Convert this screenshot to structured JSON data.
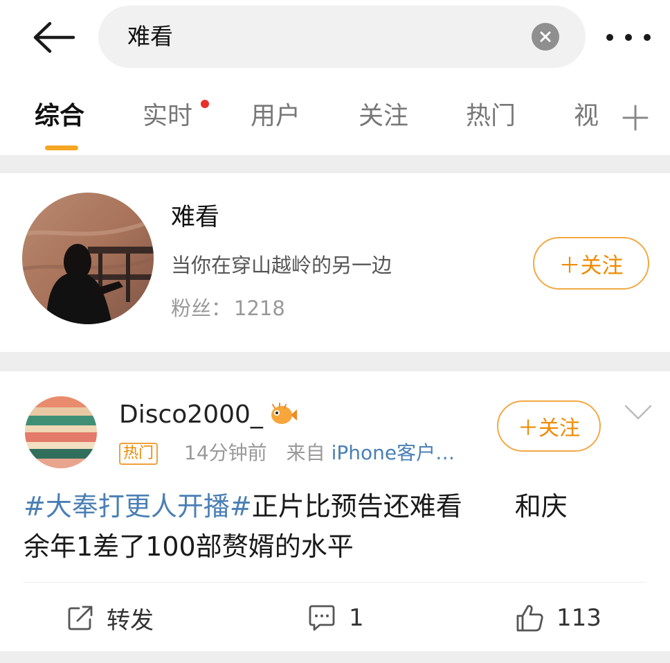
{
  "search": {
    "query": "难看"
  },
  "tabs": [
    {
      "label": "综合",
      "active": true
    },
    {
      "label": "实时",
      "has_dot": true
    },
    {
      "label": "用户"
    },
    {
      "label": "关注"
    },
    {
      "label": "热门"
    },
    {
      "label": "视"
    }
  ],
  "user_card": {
    "name": "难看",
    "description": "当你在穿山越岭的另一边",
    "fans_label": "粉丝：",
    "fans_count": "1218",
    "follow_label": "＋关注"
  },
  "post": {
    "author": "Disco2000_",
    "hot_badge": "热门",
    "time": "14分钟前",
    "source_prefix": "来自",
    "source": "iPhone客户…",
    "follow_label": "＋关注",
    "hashtag": "#大奉打更人开播#",
    "text_line1": "正片比预告还难看　　和庆",
    "text_line2": "余年1差了100部赘婿的水平",
    "actions": {
      "repost_label": "转发",
      "comment_count": "1",
      "like_count": "113"
    }
  },
  "colors": {
    "accent_orange": "#f5a623",
    "follow_orange": "#ef8a00",
    "link_blue": "#4a7fb5",
    "notification_red": "#e8302a"
  }
}
